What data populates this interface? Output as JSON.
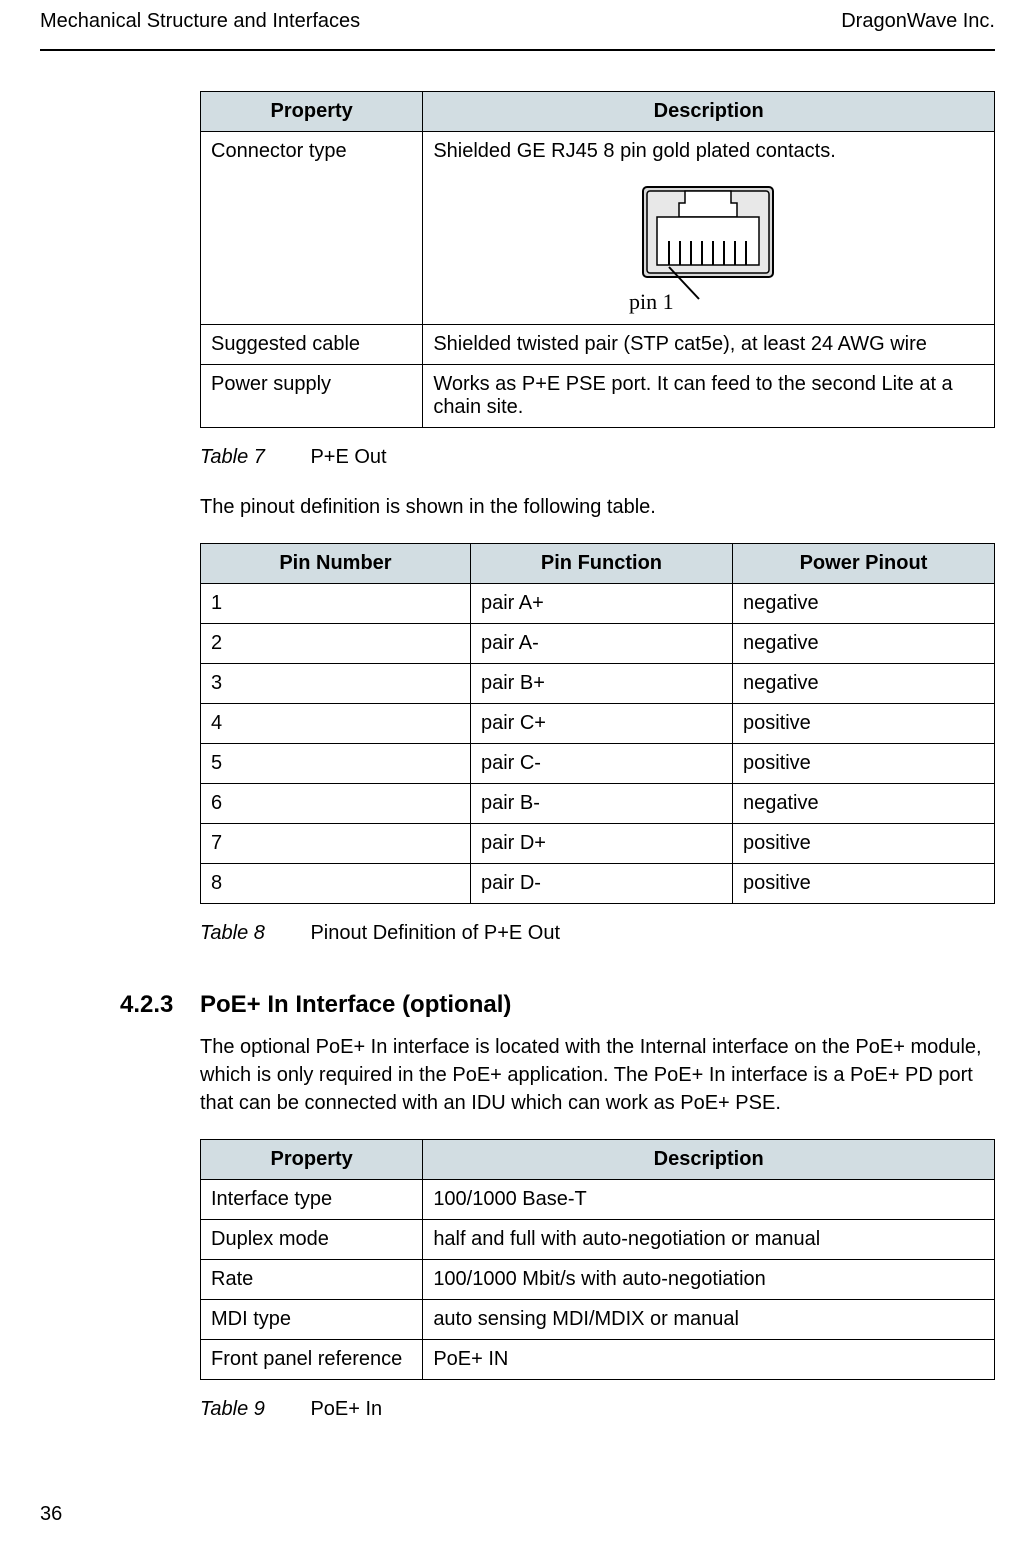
{
  "header": {
    "left": "Mechanical Structure and Interfaces",
    "right": "DragonWave Inc."
  },
  "page_number": "36",
  "table7": {
    "headers": {
      "property": "Property",
      "description": "Description"
    },
    "rows": [
      {
        "property": "Connector type",
        "description": "Shielded GE RJ45 8 pin gold plated contacts.",
        "hasImage": true,
        "pinLabel": "pin 1"
      },
      {
        "property": "Suggested cable",
        "description": "Shielded twisted pair (STP cat5e), at least 24 AWG wire"
      },
      {
        "property": "Power supply",
        "description": "Works as P+E PSE port. It can feed to the second Lite at a chain site."
      }
    ],
    "caption_label": "Table 7",
    "caption_text": "P+E Out"
  },
  "pinout_intro": "The pinout definition is shown in the following table.",
  "table8": {
    "headers": {
      "pin_number": "Pin Number",
      "pin_function": "Pin Function",
      "power_pinout": "Power Pinout"
    },
    "rows": [
      {
        "n": "1",
        "f": "pair A+",
        "p": "negative"
      },
      {
        "n": "2",
        "f": "pair A-",
        "p": "negative"
      },
      {
        "n": "3",
        "f": "pair B+",
        "p": "negative"
      },
      {
        "n": "4",
        "f": "pair C+",
        "p": "positive"
      },
      {
        "n": "5",
        "f": "pair C-",
        "p": "positive"
      },
      {
        "n": "6",
        "f": "pair B-",
        "p": "negative"
      },
      {
        "n": "7",
        "f": "pair D+",
        "p": "positive"
      },
      {
        "n": "8",
        "f": "pair D-",
        "p": "positive"
      }
    ],
    "caption_label": "Table 8",
    "caption_text": "Pinout Definition of P+E Out"
  },
  "section_4_2_3": {
    "number": "4.2.3",
    "title": "PoE+ In Interface (optional)",
    "body": "The optional PoE+ In interface is located with the Internal interface on the PoE+ module, which is only required in the PoE+ application. The PoE+ In interface is a PoE+ PD port that can be connected with an IDU which can work as PoE+ PSE."
  },
  "table9": {
    "headers": {
      "property": "Property",
      "description": "Description"
    },
    "rows": [
      {
        "property": "Interface type",
        "description": "100/1000 Base-T"
      },
      {
        "property": "Duplex mode",
        "description": "half and full with auto-negotiation or manual"
      },
      {
        "property": "Rate",
        "description": "100/1000 Mbit/s with auto-negotiation"
      },
      {
        "property": "MDI type",
        "description": "auto sensing MDI/MDIX or manual"
      },
      {
        "property": "Front panel reference",
        "description": "PoE+ IN"
      }
    ],
    "caption_label": "Table 9",
    "caption_text": "PoE+ In"
  }
}
